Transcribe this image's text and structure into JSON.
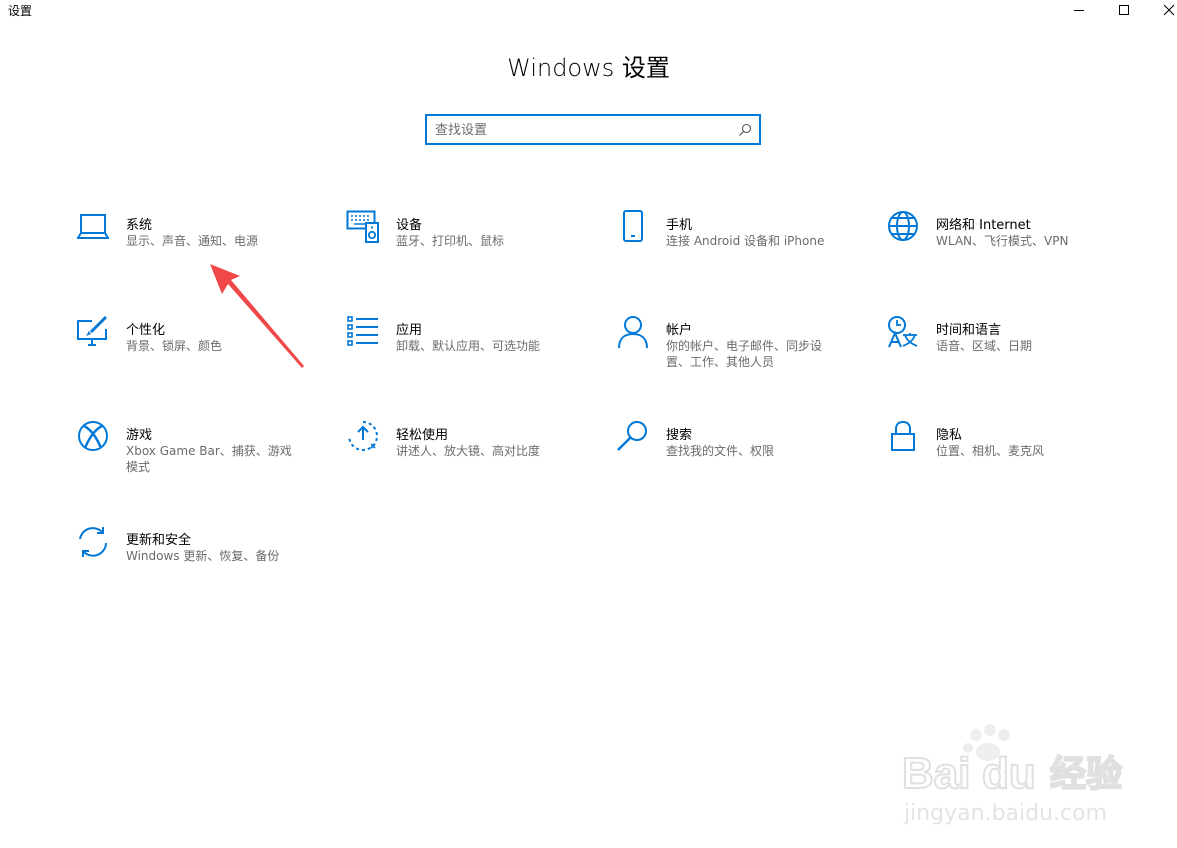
{
  "window": {
    "app_title": "设置",
    "controls": {
      "minimize": "minimize-icon",
      "maximize": "maximize-icon",
      "close": "close-icon"
    }
  },
  "page_title": "Windows 设置",
  "search": {
    "placeholder": "查找设置",
    "value": ""
  },
  "accent_color": "#0078d7",
  "annotation_arrow_color": "#f04848",
  "tiles": [
    {
      "title": "系统",
      "desc": "显示、声音、通知、电源",
      "icon": "laptop-icon"
    },
    {
      "title": "设备",
      "desc": "蓝牙、打印机、鼠标",
      "icon": "keyboard-speaker-icon"
    },
    {
      "title": "手机",
      "desc": "连接 Android 设备和 iPhone",
      "icon": "phone-icon"
    },
    {
      "title": "网络和 Internet",
      "desc": "WLAN、飞行模式、VPN",
      "icon": "globe-icon"
    },
    {
      "title": "个性化",
      "desc": "背景、锁屏、颜色",
      "icon": "paint-monitor-icon"
    },
    {
      "title": "应用",
      "desc": "卸载、默认应用、可选功能",
      "icon": "app-list-icon"
    },
    {
      "title": "帐户",
      "desc": "你的帐户、电子邮件、同步设置、工作、其他人员",
      "icon": "person-icon"
    },
    {
      "title": "时间和语言",
      "desc": "语音、区域、日期",
      "icon": "time-language-icon"
    },
    {
      "title": "游戏",
      "desc": "Xbox Game Bar、捕获、游戏模式",
      "icon": "xbox-icon"
    },
    {
      "title": "轻松使用",
      "desc": "讲述人、放大镜、高对比度",
      "icon": "ease-of-access-icon"
    },
    {
      "title": "搜索",
      "desc": "查找我的文件、权限",
      "icon": "search-icon"
    },
    {
      "title": "隐私",
      "desc": "位置、相机、麦克风",
      "icon": "lock-icon"
    },
    {
      "title": "更新和安全",
      "desc": "Windows 更新、恢复、备份",
      "icon": "sync-icon"
    }
  ],
  "watermark": {
    "brand": "Bai du 经验",
    "url": "jingyan.baidu.com"
  }
}
